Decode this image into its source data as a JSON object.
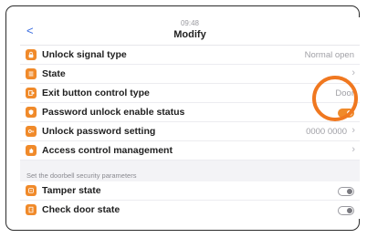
{
  "header": {
    "time": "09:48",
    "title": "Modify",
    "back": "<"
  },
  "rows": [
    {
      "label": "Unlock signal type",
      "value": "Normal open",
      "icon": "lock-icon"
    },
    {
      "label": "State",
      "value": "",
      "icon": "list-icon"
    },
    {
      "label": "Exit button control type",
      "value": "Door",
      "icon": "exit-icon"
    },
    {
      "label": "Password unlock enable status",
      "value": "",
      "icon": "shield-icon"
    },
    {
      "label": "Unlock password setting",
      "value": "0000 0000",
      "icon": "key-icon"
    },
    {
      "label": "Access control management",
      "value": "",
      "icon": "hand-icon"
    }
  ],
  "section_label": "Set the doorbell security parameters",
  "security_rows": [
    {
      "label": "Tamper state",
      "icon": "tamper-icon"
    },
    {
      "label": "Check door state",
      "icon": "door-icon"
    }
  ],
  "colors": {
    "accent": "#f08a2a",
    "highlight_ring": "#f07820",
    "back_link": "#3c6ee0"
  }
}
